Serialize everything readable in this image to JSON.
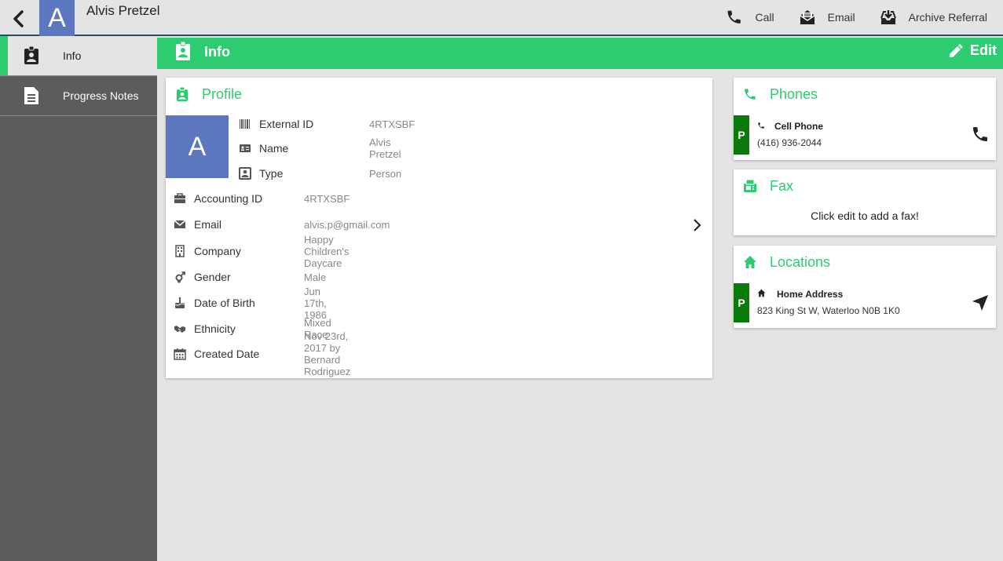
{
  "topbar": {
    "avatar_letter": "A",
    "name": "Alvis Pretzel",
    "actions": [
      {
        "label": "Call",
        "icon": "phone-icon"
      },
      {
        "label": "Email",
        "icon": "envelope-icon"
      },
      {
        "label": "Archive Referral",
        "icon": "archive-icon"
      }
    ]
  },
  "sidebar": {
    "items": [
      {
        "label": "Info",
        "icon": "id-badge-icon",
        "active": true
      },
      {
        "label": "Progress Notes",
        "icon": "document-icon",
        "active": false
      }
    ]
  },
  "header": {
    "title": "Info",
    "edit_label": "Edit"
  },
  "profile": {
    "title": "Profile",
    "avatar_letter": "A",
    "top_fields": [
      {
        "label": "External ID",
        "value": "4RTXSBF",
        "icon": "barcode-icon"
      },
      {
        "label": "Name",
        "value": "Alvis Pretzel",
        "icon": "id-card-icon"
      },
      {
        "label": "Type",
        "value": "Person",
        "icon": "person-card-icon"
      }
    ],
    "fields": [
      {
        "label": "Accounting ID",
        "value": "4RTXSBF",
        "icon": "briefcase-icon"
      },
      {
        "label": "Email",
        "value": "alvis.p@gmail.com",
        "icon": "envelope-icon"
      },
      {
        "label": "Company",
        "value": "Happy Children's Daycare",
        "icon": "building-icon"
      },
      {
        "label": "Gender",
        "value": "Male",
        "icon": "gender-icon"
      },
      {
        "label": "Date of Birth",
        "value": "Jun 17th, 1986",
        "icon": "cake-icon"
      },
      {
        "label": "Ethnicity",
        "value": "Mixed Race",
        "icon": "handshake-icon"
      },
      {
        "label": "Created Date",
        "value": "Nov 23rd, 2017 by Bernard Rodriguez",
        "icon": "calendar-icon"
      }
    ]
  },
  "phones": {
    "title": "Phones",
    "badge": "P",
    "entry_title": "Cell Phone",
    "entry_value": "(416) 936-2044"
  },
  "fax": {
    "title": "Fax",
    "empty_text": "Click edit to add a fax!"
  },
  "locations": {
    "title": "Locations",
    "badge": "P",
    "entry_title": "Home Address",
    "entry_value": "823 King St W, Waterloo N0B 1K0"
  },
  "colors": {
    "accent": "#2ecc71",
    "avatar": "#5c77bf",
    "badge": "#0b7a0b",
    "sidebar": "#5c5c5c"
  }
}
